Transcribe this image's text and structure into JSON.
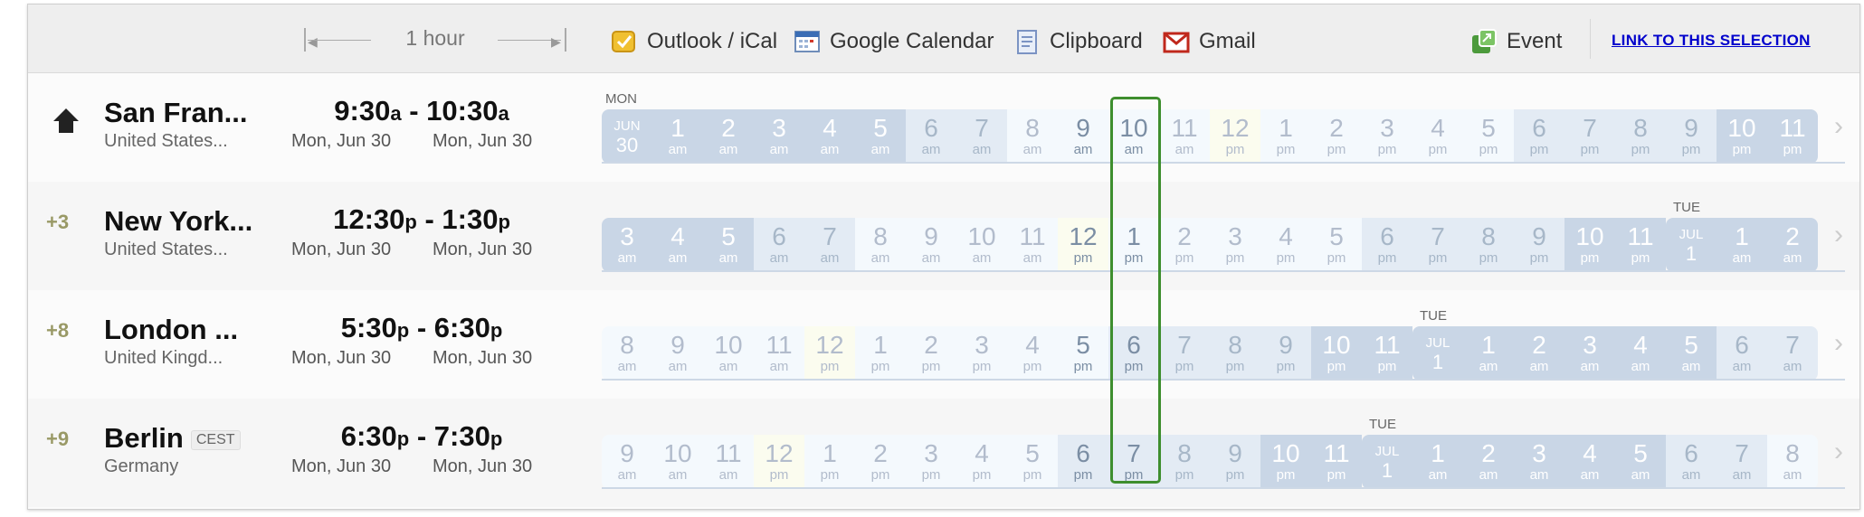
{
  "toolbar": {
    "duration_label": "1 hour",
    "items": [
      {
        "label": "Outlook / iCal",
        "icon": "outlook-icon"
      },
      {
        "label": "Google Calendar",
        "icon": "google-calendar-icon"
      },
      {
        "label": "Clipboard",
        "icon": "clipboard-icon"
      },
      {
        "label": "Gmail",
        "icon": "gmail-icon"
      }
    ],
    "event_label": "Event",
    "link_label": "LINK TO THIS SELECTION"
  },
  "rows": [
    {
      "offset": "",
      "city": "San Fran...",
      "tz_badge": "",
      "country": "United States...",
      "start_time": "9:30",
      "start_ampm": "a",
      "end_time": "10:30",
      "end_ampm": "a",
      "start_date": "Mon, Jun 30",
      "end_date": "Mon, Jun 30",
      "day_label": "MON",
      "next_day_label": "",
      "cells": [
        {
          "t": "date",
          "mo": "JUN",
          "dy": "30",
          "c": "night"
        },
        {
          "h": "1",
          "m": "am",
          "c": "night"
        },
        {
          "h": "2",
          "m": "am",
          "c": "night"
        },
        {
          "h": "3",
          "m": "am",
          "c": "night"
        },
        {
          "h": "4",
          "m": "am",
          "c": "night"
        },
        {
          "h": "5",
          "m": "am",
          "c": "night"
        },
        {
          "h": "6",
          "m": "am",
          "c": "dawn"
        },
        {
          "h": "7",
          "m": "am",
          "c": "dawn"
        },
        {
          "h": "8",
          "m": "am",
          "c": "work"
        },
        {
          "h": "9",
          "m": "am",
          "c": "work",
          "sel": true
        },
        {
          "h": "10",
          "m": "am",
          "c": "work",
          "sel": true
        },
        {
          "h": "11",
          "m": "am",
          "c": "work"
        },
        {
          "h": "12",
          "m": "pm",
          "c": "noon"
        },
        {
          "h": "1",
          "m": "pm",
          "c": "work"
        },
        {
          "h": "2",
          "m": "pm",
          "c": "work"
        },
        {
          "h": "3",
          "m": "pm",
          "c": "work"
        },
        {
          "h": "4",
          "m": "pm",
          "c": "work"
        },
        {
          "h": "5",
          "m": "pm",
          "c": "work"
        },
        {
          "h": "6",
          "m": "pm",
          "c": "dawn"
        },
        {
          "h": "7",
          "m": "pm",
          "c": "dawn"
        },
        {
          "h": "8",
          "m": "pm",
          "c": "dawn"
        },
        {
          "h": "9",
          "m": "pm",
          "c": "dawn"
        },
        {
          "h": "10",
          "m": "pm",
          "c": "night"
        },
        {
          "h": "11",
          "m": "pm",
          "c": "night"
        }
      ]
    },
    {
      "offset": "+3",
      "city": "New York...",
      "tz_badge": "",
      "country": "United States...",
      "start_time": "12:30",
      "start_ampm": "p",
      "end_time": "1:30",
      "end_ampm": "p",
      "start_date": "Mon, Jun 30",
      "end_date": "Mon, Jun 30",
      "day_label": "",
      "next_day_label": "TUE",
      "cells": [
        {
          "h": "3",
          "m": "am",
          "c": "night"
        },
        {
          "h": "4",
          "m": "am",
          "c": "night"
        },
        {
          "h": "5",
          "m": "am",
          "c": "night"
        },
        {
          "h": "6",
          "m": "am",
          "c": "dawn"
        },
        {
          "h": "7",
          "m": "am",
          "c": "dawn"
        },
        {
          "h": "8",
          "m": "am",
          "c": "work"
        },
        {
          "h": "9",
          "m": "am",
          "c": "work"
        },
        {
          "h": "10",
          "m": "am",
          "c": "work"
        },
        {
          "h": "11",
          "m": "am",
          "c": "work"
        },
        {
          "h": "12",
          "m": "pm",
          "c": "noon",
          "sel": true
        },
        {
          "h": "1",
          "m": "pm",
          "c": "work",
          "sel": true
        },
        {
          "h": "2",
          "m": "pm",
          "c": "work"
        },
        {
          "h": "3",
          "m": "pm",
          "c": "work"
        },
        {
          "h": "4",
          "m": "pm",
          "c": "work"
        },
        {
          "h": "5",
          "m": "pm",
          "c": "work"
        },
        {
          "h": "6",
          "m": "pm",
          "c": "dawn"
        },
        {
          "h": "7",
          "m": "pm",
          "c": "dawn"
        },
        {
          "h": "8",
          "m": "pm",
          "c": "dawn"
        },
        {
          "h": "9",
          "m": "pm",
          "c": "dawn"
        },
        {
          "h": "10",
          "m": "pm",
          "c": "night"
        },
        {
          "h": "11",
          "m": "pm",
          "c": "night"
        },
        {
          "t": "date",
          "mo": "JUL",
          "dy": "1",
          "c": "night"
        },
        {
          "h": "1",
          "m": "am",
          "c": "night"
        },
        {
          "h": "2",
          "m": "am",
          "c": "night"
        }
      ]
    },
    {
      "offset": "+8",
      "city": "London ...",
      "tz_badge": "",
      "country": "United Kingd...",
      "start_time": "5:30",
      "start_ampm": "p",
      "end_time": "6:30",
      "end_ampm": "p",
      "start_date": "Mon, Jun 30",
      "end_date": "Mon, Jun 30",
      "day_label": "",
      "next_day_label": "TUE",
      "cells": [
        {
          "h": "8",
          "m": "am",
          "c": "work"
        },
        {
          "h": "9",
          "m": "am",
          "c": "work"
        },
        {
          "h": "10",
          "m": "am",
          "c": "work"
        },
        {
          "h": "11",
          "m": "am",
          "c": "work"
        },
        {
          "h": "12",
          "m": "pm",
          "c": "noon"
        },
        {
          "h": "1",
          "m": "pm",
          "c": "work"
        },
        {
          "h": "2",
          "m": "pm",
          "c": "work"
        },
        {
          "h": "3",
          "m": "pm",
          "c": "work"
        },
        {
          "h": "4",
          "m": "pm",
          "c": "work"
        },
        {
          "h": "5",
          "m": "pm",
          "c": "work",
          "sel": true
        },
        {
          "h": "6",
          "m": "pm",
          "c": "dawn",
          "sel": true
        },
        {
          "h": "7",
          "m": "pm",
          "c": "dawn"
        },
        {
          "h": "8",
          "m": "pm",
          "c": "dawn"
        },
        {
          "h": "9",
          "m": "pm",
          "c": "dawn"
        },
        {
          "h": "10",
          "m": "pm",
          "c": "night"
        },
        {
          "h": "11",
          "m": "pm",
          "c": "night"
        },
        {
          "t": "date",
          "mo": "JUL",
          "dy": "1",
          "c": "night"
        },
        {
          "h": "1",
          "m": "am",
          "c": "night"
        },
        {
          "h": "2",
          "m": "am",
          "c": "night"
        },
        {
          "h": "3",
          "m": "am",
          "c": "night"
        },
        {
          "h": "4",
          "m": "am",
          "c": "night"
        },
        {
          "h": "5",
          "m": "am",
          "c": "night"
        },
        {
          "h": "6",
          "m": "am",
          "c": "dawn"
        },
        {
          "h": "7",
          "m": "am",
          "c": "dawn"
        }
      ]
    },
    {
      "offset": "+9",
      "city": "Berlin",
      "tz_badge": "CEST",
      "country": "Germany",
      "start_time": "6:30",
      "start_ampm": "p",
      "end_time": "7:30",
      "end_ampm": "p",
      "start_date": "Mon, Jun 30",
      "end_date": "Mon, Jun 30",
      "day_label": "",
      "next_day_label": "TUE",
      "cells": [
        {
          "h": "9",
          "m": "am",
          "c": "work"
        },
        {
          "h": "10",
          "m": "am",
          "c": "work"
        },
        {
          "h": "11",
          "m": "am",
          "c": "work"
        },
        {
          "h": "12",
          "m": "pm",
          "c": "noon"
        },
        {
          "h": "1",
          "m": "pm",
          "c": "work"
        },
        {
          "h": "2",
          "m": "pm",
          "c": "work"
        },
        {
          "h": "3",
          "m": "pm",
          "c": "work"
        },
        {
          "h": "4",
          "m": "pm",
          "c": "work"
        },
        {
          "h": "5",
          "m": "pm",
          "c": "work"
        },
        {
          "h": "6",
          "m": "pm",
          "c": "dawn",
          "sel": true
        },
        {
          "h": "7",
          "m": "pm",
          "c": "dawn",
          "sel": true
        },
        {
          "h": "8",
          "m": "pm",
          "c": "dawn"
        },
        {
          "h": "9",
          "m": "pm",
          "c": "dawn"
        },
        {
          "h": "10",
          "m": "pm",
          "c": "night"
        },
        {
          "h": "11",
          "m": "pm",
          "c": "night"
        },
        {
          "t": "date",
          "mo": "JUL",
          "dy": "1",
          "c": "night"
        },
        {
          "h": "1",
          "m": "am",
          "c": "night"
        },
        {
          "h": "2",
          "m": "am",
          "c": "night"
        },
        {
          "h": "3",
          "m": "am",
          "c": "night"
        },
        {
          "h": "4",
          "m": "am",
          "c": "night"
        },
        {
          "h": "5",
          "m": "am",
          "c": "night"
        },
        {
          "h": "6",
          "m": "am",
          "c": "dawn"
        },
        {
          "h": "7",
          "m": "am",
          "c": "dawn"
        },
        {
          "h": "8",
          "m": "am",
          "c": "work"
        }
      ]
    }
  ]
}
